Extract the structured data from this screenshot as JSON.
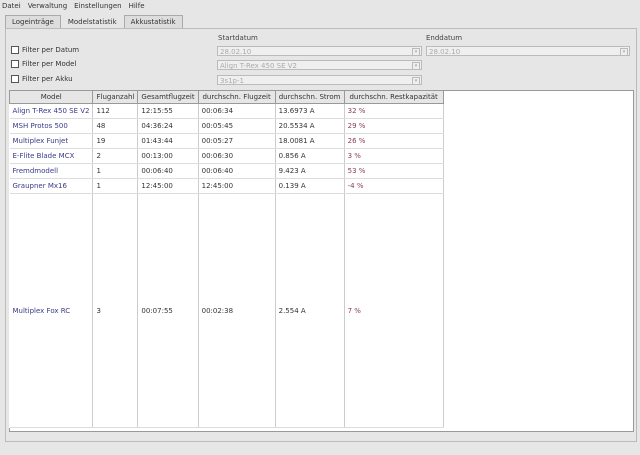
{
  "menu": [
    "Datei",
    "Verwaltung",
    "Einstellungen",
    "Hilfe"
  ],
  "tabs": [
    "Logeinträge",
    "Modelstatistik",
    "Akkustatistik"
  ],
  "active_tab": "Modelstatistik",
  "filters": {
    "start_label": "Startdatum",
    "end_label": "Enddatum",
    "date_label": "Filter per Datum",
    "model_label": "Filter per Model",
    "akku_label": "Filter per Akku",
    "start_value": "28.02.10",
    "end_value": "28.02.10",
    "model_value": "Align T-Rex 450 SE V2",
    "akku_value": "3s1p-1"
  },
  "table": {
    "columns": [
      "Model",
      "Fluganzahl",
      "Gesamtflugzeit",
      "durchschn. Flugzeit",
      "durchschn. Strom",
      "durchschn. Restkapazität"
    ],
    "rows": [
      [
        "Align T-Rex 450 SE V2",
        "112",
        "12:15:55",
        "00:06:34",
        "13.6973 A",
        "32 %"
      ],
      [
        "MSH Protos 500",
        "48",
        "04:36:24",
        "00:05:45",
        "20.5534 A",
        "29 %"
      ],
      [
        "Multiplex Funjet",
        "19",
        "01:43:44",
        "00:05:27",
        "18.0081 A",
        "26 %"
      ],
      [
        "E-Flite Blade MCX",
        "2",
        "00:13:00",
        "00:06:30",
        "0.856 A",
        "3 %"
      ],
      [
        "Fremdmodell",
        "1",
        "00:06:40",
        "00:06:40",
        "9.423 A",
        "53 %"
      ],
      [
        "Graupner Mx16",
        "1",
        "12:45:00",
        "12:45:00",
        "0.139 A",
        "-4 %"
      ],
      [
        "Multiplex Fox RC",
        "3",
        "00:07:55",
        "00:02:38",
        "2.554 A",
        "7 %"
      ]
    ]
  }
}
